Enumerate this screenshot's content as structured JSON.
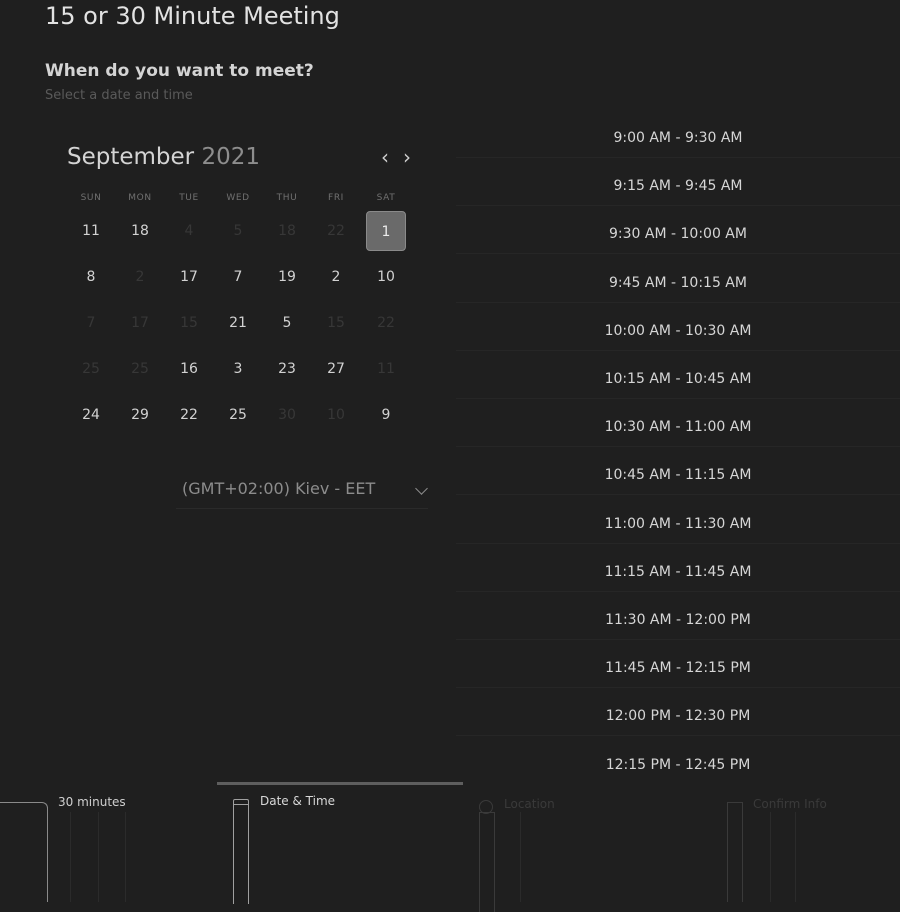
{
  "page": {
    "title": "15 or 30 Minute Meeting",
    "question": "When do you want to meet?",
    "hint": "Select a date and time"
  },
  "calendar": {
    "month": "September",
    "year": "2021",
    "weekdays": [
      "SUN",
      "MON",
      "TUE",
      "WED",
      "THU",
      "FRI",
      "SAT"
    ],
    "selected_day": "1",
    "rows": [
      [
        {
          "t": "11",
          "on": true
        },
        {
          "t": "18",
          "on": true
        },
        {
          "t": "4",
          "on": false
        },
        {
          "t": "5",
          "on": false
        },
        {
          "t": "18",
          "on": false
        },
        {
          "t": "22",
          "on": false
        },
        {
          "t": "1",
          "on": true,
          "sel": true
        }
      ],
      [
        {
          "t": "8",
          "on": true
        },
        {
          "t": "2",
          "on": false
        },
        {
          "t": "17",
          "on": true
        },
        {
          "t": "7",
          "on": true
        },
        {
          "t": "19",
          "on": true
        },
        {
          "t": "2",
          "on": true
        },
        {
          "t": "10",
          "on": true
        }
      ],
      [
        {
          "t": "7",
          "on": false
        },
        {
          "t": "17",
          "on": false
        },
        {
          "t": "15",
          "on": false
        },
        {
          "t": "21",
          "on": true
        },
        {
          "t": "5",
          "on": true
        },
        {
          "t": "15",
          "on": false
        },
        {
          "t": "22",
          "on": false
        }
      ],
      [
        {
          "t": "25",
          "on": false
        },
        {
          "t": "25",
          "on": false
        },
        {
          "t": "16",
          "on": true
        },
        {
          "t": "3",
          "on": true
        },
        {
          "t": "23",
          "on": true
        },
        {
          "t": "27",
          "on": true
        },
        {
          "t": "11",
          "on": false
        }
      ],
      [
        {
          "t": "24",
          "on": true
        },
        {
          "t": "29",
          "on": true
        },
        {
          "t": "22",
          "on": true
        },
        {
          "t": "25",
          "on": true
        },
        {
          "t": "30",
          "on": false
        },
        {
          "t": "10",
          "on": false
        },
        {
          "t": "9",
          "on": true
        }
      ]
    ]
  },
  "timezone": {
    "label": "(GMT+02:00) Kiev - EET"
  },
  "time_slots": [
    "9:00 AM - 9:30 AM",
    "9:15 AM - 9:45 AM",
    "9:30 AM - 10:00 AM",
    "9:45 AM - 10:15 AM",
    "10:00 AM - 10:30 AM",
    "10:15 AM - 10:45 AM",
    "10:30 AM - 11:00 AM",
    "10:45 AM - 11:15 AM",
    "11:00 AM - 11:30 AM",
    "11:15 AM - 11:45 AM",
    "11:30 AM - 12:00 PM",
    "11:45 AM - 12:15 PM",
    "12:00 PM - 12:30 PM",
    "12:15 PM - 12:45 PM"
  ],
  "steps": [
    {
      "label": "30 minutes",
      "state": "done",
      "icon": "clock-icon"
    },
    {
      "label": "Date & Time",
      "state": "active",
      "icon": "calendar-icon"
    },
    {
      "label": "Location",
      "state": "pending",
      "icon": "location-pin-icon"
    },
    {
      "label": "Confirm Info",
      "state": "pending",
      "icon": "document-icon"
    }
  ],
  "colors": {
    "background": "#1f1f1f",
    "selected_day_bg": "#6a6a6a",
    "active_step_bar": "#5e5e5e"
  }
}
